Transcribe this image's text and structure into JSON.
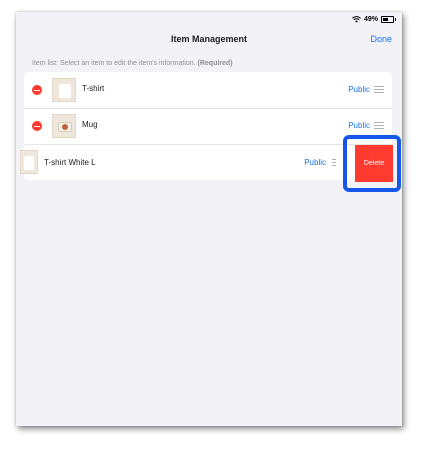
{
  "status": {
    "battery": "49%"
  },
  "nav": {
    "title": "Item Management",
    "done_label": "Done"
  },
  "section": {
    "label": "Item list: Select an item to edit the item's information.",
    "required": "(Required)"
  },
  "items": [
    {
      "name": "T-shirt",
      "visibility": "Public",
      "thumb": "tshirt-thumbnail"
    },
    {
      "name": "Mug",
      "visibility": "Public",
      "thumb": "mug-thumbnail"
    },
    {
      "name": "T-shirt White L",
      "visibility": "Public",
      "thumb": "tshirt-thumbnail"
    }
  ],
  "swipe_action": {
    "delete_label": "Delete",
    "color": "#ff3b30"
  },
  "colors": {
    "accent": "#1a73e8",
    "highlight": "#1557e8",
    "destructive": "#ff3b30",
    "background": "#f2f2f7"
  },
  "icons": [
    "wifi-icon",
    "battery-icon",
    "minus-circle-icon",
    "reorder-handle-icon"
  ]
}
